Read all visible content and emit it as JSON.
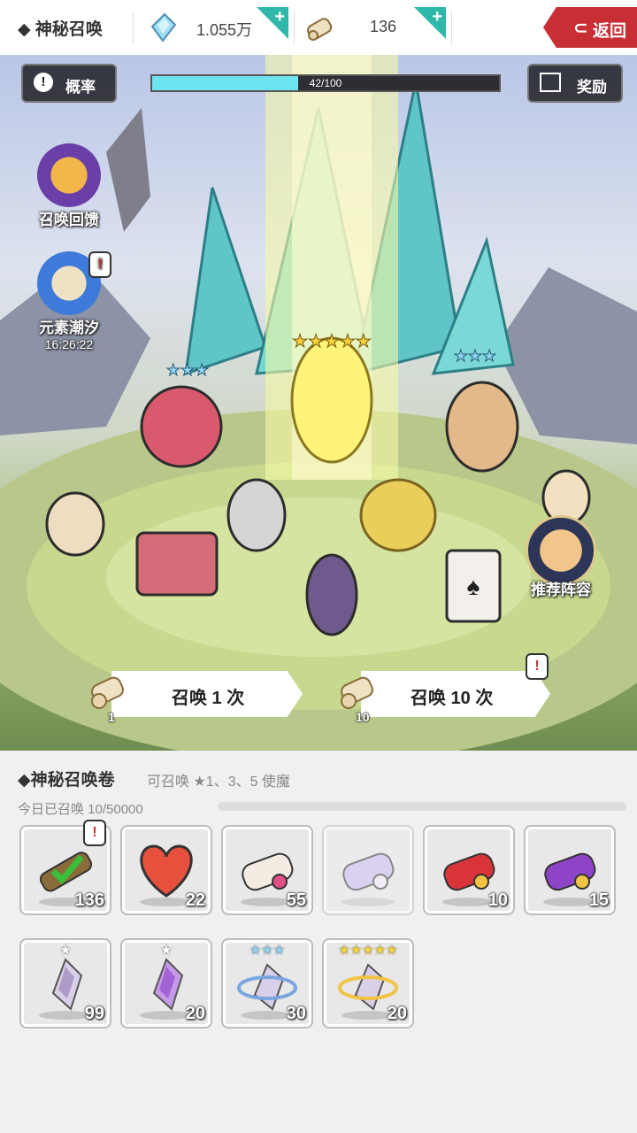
{
  "top_bar": {
    "title": "◆ 神秘召唤",
    "diamond": {
      "value": "1.055万",
      "icon": "crystal-icon"
    },
    "scroll": {
      "value": "136",
      "icon": "scroll-icon"
    },
    "plus_label": "+",
    "back_label": "返回"
  },
  "scene": {
    "prob_label": "概率",
    "reward_label": "奖励",
    "progress": {
      "current": 42,
      "max": 100,
      "text": "42/100"
    },
    "side": {
      "feedback_label": "召唤回馈",
      "element_label": "元素潮汐",
      "element_timer": "16:26:22",
      "lineup_label": "推荐阵容"
    },
    "summon_once": {
      "label": "召唤 1 次",
      "cost": "1"
    },
    "summon_ten": {
      "label": "召唤 10 次",
      "cost": "10"
    },
    "notice": "!"
  },
  "panel": {
    "title": "◆神秘召唤卷",
    "subtitle": "可召唤 ★1、3、5 使魔",
    "today": "今日已召唤 10/50000",
    "items": [
      {
        "name": "scroll-check",
        "count": "136",
        "icon": "scroll-check-icon",
        "colors": [
          "#8a6b3a",
          "#3bbf3a"
        ]
      },
      {
        "name": "heart",
        "count": "22",
        "icon": "heart-icon",
        "colors": [
          "#e8503e",
          "#f07a66"
        ]
      },
      {
        "name": "pink-scroll",
        "count": "55",
        "icon": "scroll-icon",
        "colors": [
          "#f3ece2",
          "#e04f86"
        ]
      },
      {
        "name": "purple-scroll",
        "count": "",
        "icon": "scroll-icon",
        "colors": [
          "#c7b8ef",
          "#f1e8f8"
        ]
      },
      {
        "name": "red-scroll",
        "count": "10",
        "icon": "scroll-icon",
        "colors": [
          "#d8343a",
          "#f2c443"
        ]
      },
      {
        "name": "violet-scroll",
        "count": "15",
        "icon": "scroll-icon",
        "colors": [
          "#8e44c6",
          "#f2c443"
        ]
      },
      {
        "name": "crystal-1",
        "count": "99",
        "stars": "★",
        "icon": "crystal-shard-icon",
        "colors": [
          "#d9cfe8",
          "#8f79b3"
        ]
      },
      {
        "name": "crystal-1-purple",
        "count": "20",
        "stars": "★",
        "icon": "crystal-shard-icon",
        "colors": [
          "#c69ae8",
          "#8b3fc6"
        ]
      },
      {
        "name": "crystal-3",
        "count": "30",
        "stars": "★★★",
        "icon": "crystal-ring-icon",
        "colors": [
          "#d9cfe8",
          "#7aa6e0"
        ]
      },
      {
        "name": "crystal-5",
        "count": "20",
        "stars": "★★★★★",
        "icon": "crystal-ring-icon",
        "colors": [
          "#d9cfe8",
          "#f2c443"
        ]
      }
    ]
  }
}
